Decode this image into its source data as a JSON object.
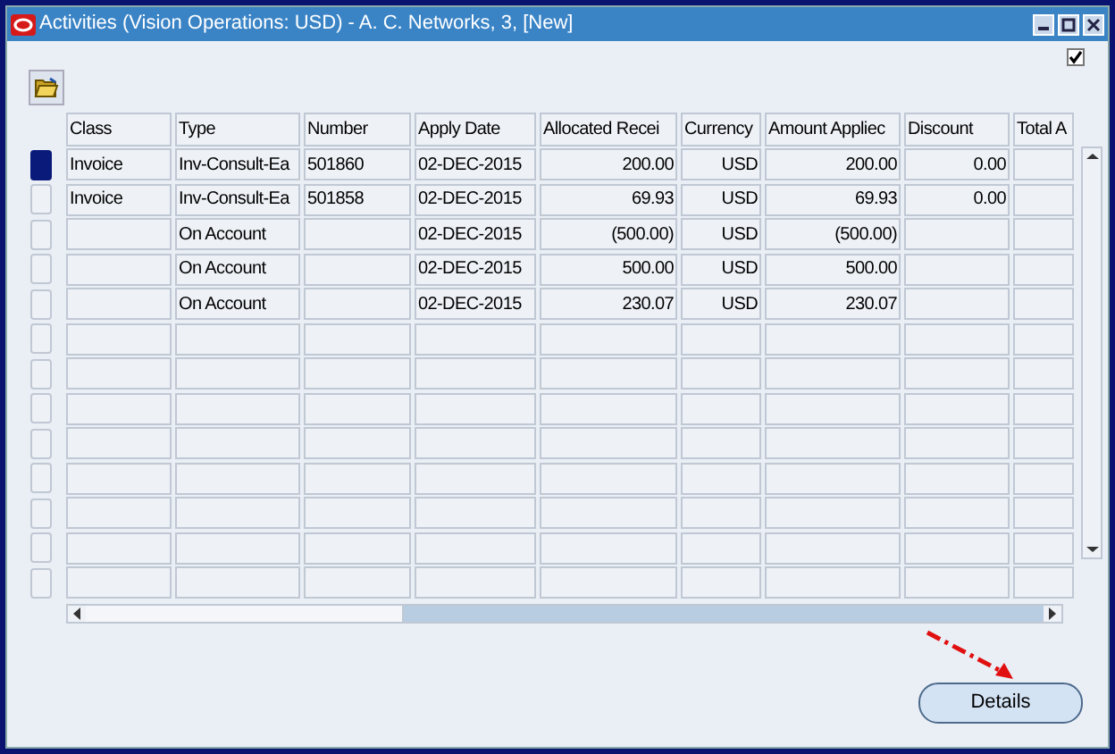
{
  "window": {
    "title": "Activities (Vision Operations: USD) - A. C. Networks, 3, [New]"
  },
  "top_checkbox": {
    "checked": true
  },
  "table": {
    "columns": [
      "Class",
      "Type",
      "Number",
      "Apply Date",
      "Allocated Recei",
      "Currency",
      "Amount Appliec",
      "Discount",
      "Total A"
    ],
    "rows": [
      {
        "selected": true,
        "class": "Invoice",
        "type": "Inv-Consult-Ea",
        "number": "501860",
        "apply_date": "02-DEC-2015",
        "allocated": "200.00",
        "currency": "USD",
        "amount_applied": "200.00",
        "discount": "0.00"
      },
      {
        "selected": false,
        "class": "Invoice",
        "type": "Inv-Consult-Ea",
        "number": "501858",
        "apply_date": "02-DEC-2015",
        "allocated": "69.93",
        "currency": "USD",
        "amount_applied": "69.93",
        "discount": "0.00"
      },
      {
        "selected": false,
        "type": "On Account",
        "apply_date": "02-DEC-2015",
        "allocated": "(500.00)",
        "currency": "USD",
        "amount_applied": "(500.00)"
      },
      {
        "selected": false,
        "type": "On Account",
        "apply_date": "02-DEC-2015",
        "allocated": "500.00",
        "currency": "USD",
        "amount_applied": "500.00"
      },
      {
        "selected": false,
        "type": "On Account",
        "apply_date": "02-DEC-2015",
        "allocated": "230.07",
        "currency": "USD",
        "amount_applied": "230.07"
      },
      {
        "selected": false
      },
      {
        "selected": false
      },
      {
        "selected": false
      },
      {
        "selected": false
      },
      {
        "selected": false
      },
      {
        "selected": false
      },
      {
        "selected": false
      },
      {
        "selected": false
      }
    ]
  },
  "buttons": [
    {
      "label": "Details"
    }
  ]
}
